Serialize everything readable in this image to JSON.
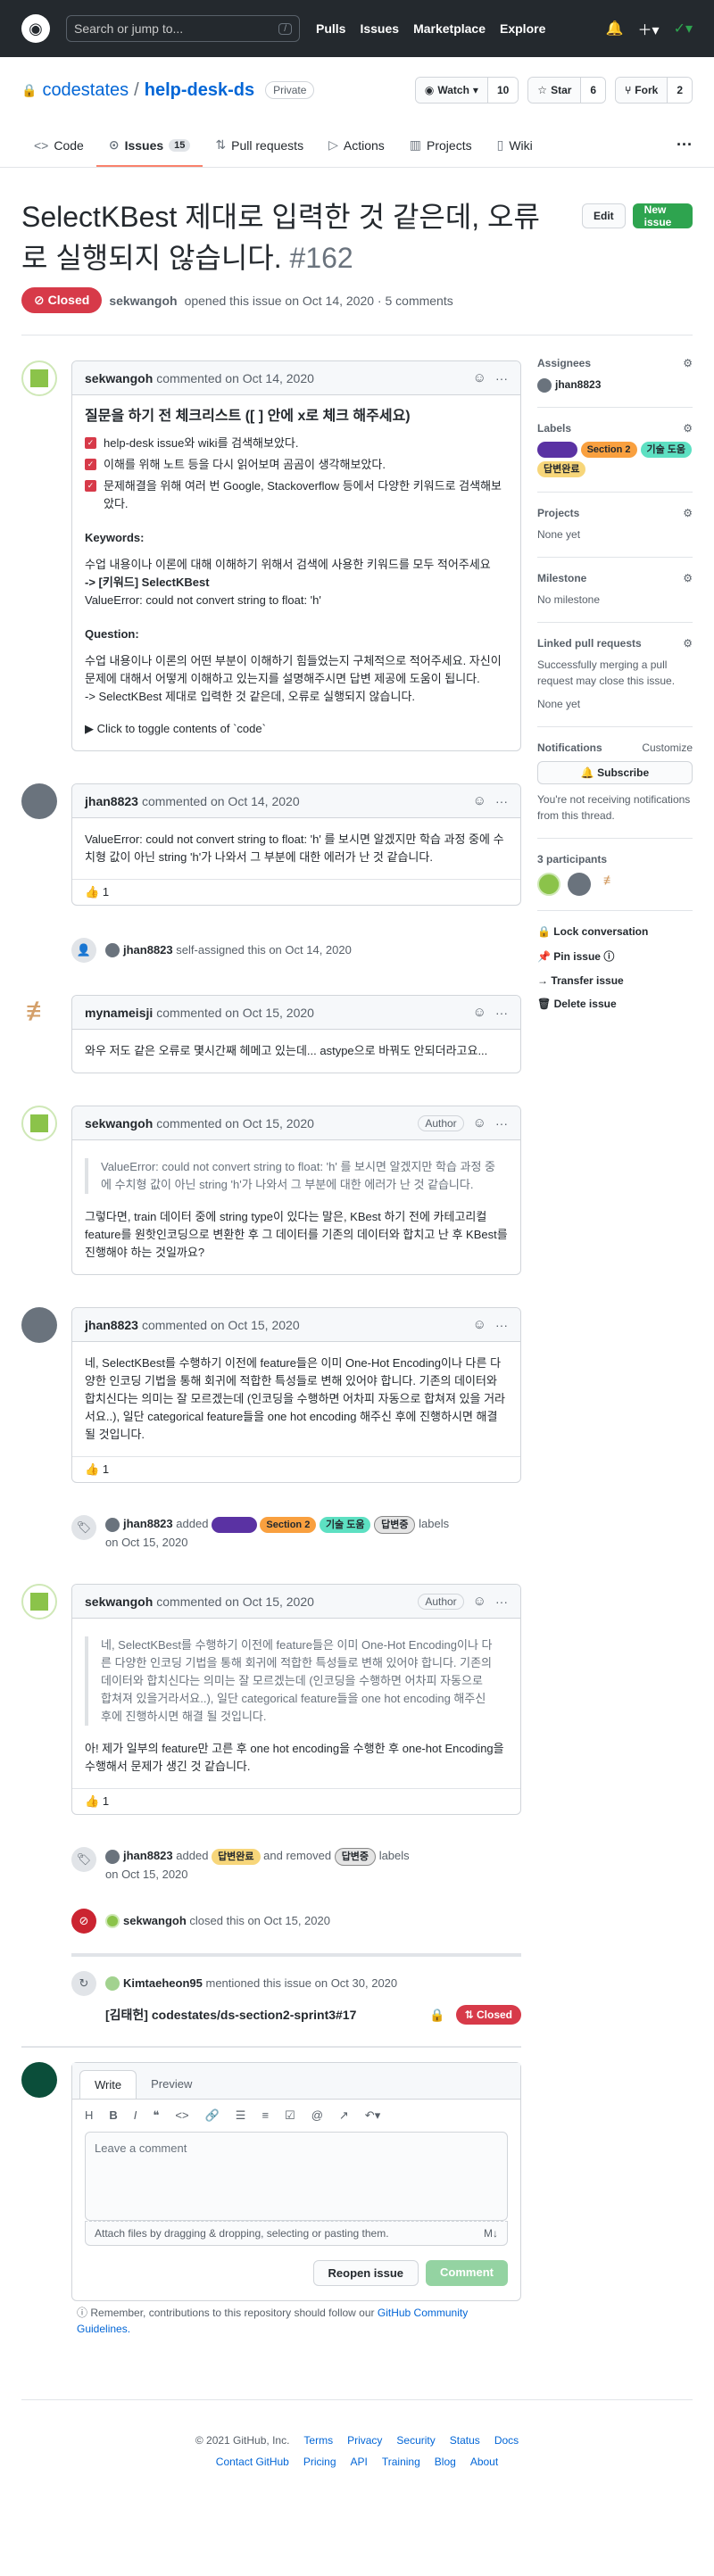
{
  "header": {
    "search_placeholder": "Search or jump to...",
    "search_key": "/",
    "nav": [
      "Pulls",
      "Issues",
      "Marketplace",
      "Explore"
    ]
  },
  "repo": {
    "owner": "codestates",
    "name": "help-desk-ds",
    "visibility": "Private",
    "watch_label": "Watch",
    "watch_count": "10",
    "star_label": "Star",
    "star_count": "6",
    "fork_label": "Fork",
    "fork_count": "2"
  },
  "tabs": {
    "code": "Code",
    "issues": "Issues",
    "issues_count": "15",
    "pulls": "Pull requests",
    "actions": "Actions",
    "projects": "Projects",
    "wiki": "Wiki"
  },
  "issue": {
    "title": "SelectKBest 제대로 입력한 것 같은데, 오류로 실행되지 않습니다.",
    "number": "#162",
    "state": "Closed",
    "author": "sekwangoh",
    "meta": "opened this issue on Oct 14, 2020 · 5 comments",
    "edit_label": "Edit",
    "new_label": "New issue"
  },
  "comments": [
    {
      "author": "sekwangoh",
      "date": "commented on Oct 14, 2020",
      "heading": "질문을 하기 전 체크리스트 ([ ] 안에 x로 체크 해주세요)",
      "checks": [
        "help-desk issue와 wiki를 검색해보았다.",
        "이해를 위해 노트 등을 다시 읽어보며 곰곰이 생각해보았다.",
        "문제해결을 위해 여러 번 Google, Stackoverflow 등에서 다양한 키워드로 검색해보았다."
      ],
      "kw_label": "Keywords:",
      "kw_text1": "수업 내용이나 이론에 대해 이해하기 위해서 검색에 사용한 키워드를 모두 적어주세요",
      "kw_text2": "-> [키워드] SelectKBest",
      "kw_text3": "ValueError: could not convert string to float: 'h'",
      "q_label": "Question:",
      "q_text1": "수업 내용이나 이론의 어떤 부분이 이해하기 힘들었는지 구체적으로 적어주세요. 자신이 문제에 대해서 어떻게 이해하고 있는지를 설명해주시면 답변 제공에 도움이 됩니다.",
      "q_text2": "-> SelectKBest 제대로 입력한 것 같은데, 오류로 실행되지 않습니다.",
      "toggle": "Click to toggle contents of `code`"
    },
    {
      "author": "jhan8823",
      "date": "commented on Oct 14, 2020",
      "body": "ValueError: could not convert string to float: 'h' 를 보시면 알겠지만 학습 과정 중에 수치형 값이 아닌 string 'h'가 나와서 그 부분에 대한 에러가 난 것 같습니다.",
      "reaction": "1"
    },
    {
      "author": "mynameisji",
      "date": "commented on Oct 15, 2020",
      "body": "와우 저도 같은 오류로 몇시간째 헤메고 있는데... astype으로 바꿔도 안되더라고요..."
    },
    {
      "author": "sekwangoh",
      "date": "commented on Oct 15, 2020",
      "badge": "Author",
      "quote": "ValueError: could not convert string to float: 'h' 를 보시면 알겠지만 학습 과정 중에 수치형 값이 아닌 string 'h'가 나와서 그 부분에 대한 에러가 난 것 같습니다.",
      "body": "그렇다면, train 데이터 중에 string type이 있다는 말은, KBest 하기 전에 카테고리컬 feature를 원핫인코딩으로 변환한 후 그 데이터를 기존의 데이터와 합치고 난 후 KBest를 진행해야 하는 것일까요?"
    },
    {
      "author": "jhan8823",
      "date": "commented on Oct 15, 2020",
      "body": "네, SelectKBest를 수행하기 이전에 feature들은 이미 One-Hot Encoding이나 다른 다양한 인코딩 기법을 통해 회귀에 적합한 특성들로 변해 있어야 합니다. 기존의 데이터와 합치신다는 의미는 잘 모르겠는데 (인코딩을 수행하면 어차피 자동으로 합쳐져 있을 거라서요..), 일단 categorical feature들을 one hot encoding 해주신 후에 진행하시면 해결 될 것입니다.",
      "reaction": "1"
    },
    {
      "author": "sekwangoh",
      "date": "commented on Oct 15, 2020",
      "badge": "Author",
      "quote": "네, SelectKBest를 수행하기 이전에 feature들은 이미 One-Hot Encoding이나 다른 다양한 인코딩 기법을 통해 회귀에 적합한 특성들로 변해 있어야 합니다. 기존의 데이터와 합치신다는 의미는 잘 모르겠는데 (인코딩을 수행하면 어차피 자동으로 합쳐져 있을거라서요..), 일단 categorical feature들을 one hot encoding 해주신 후에 진행하시면 해결 될 것입니다.",
      "body": "아! 제가 일부의 feature만 고른 후 one hot encoding을 수행한 후 one-hot Encoding을 수행해서 문제가 생긴 것 같습니다.",
      "reaction": "1"
    }
  ],
  "events": {
    "assign": {
      "user": "jhan8823",
      "text": "self-assigned this on Oct 14, 2020"
    },
    "label1": {
      "user": "jhan8823",
      "added": "added",
      "labels_text": "labels",
      "date": "on Oct 15, 2020"
    },
    "label2": {
      "user": "jhan8823",
      "added": "added",
      "removed": "and removed",
      "labels_text": "labels",
      "date": "on Oct 15, 2020"
    },
    "closed": {
      "user": "sekwangoh",
      "text": "closed this on Oct 15, 2020"
    },
    "mention": {
      "user": "Kimtaeheon95",
      "text": "mentioned this issue on Oct 30, 2020",
      "link": "[김태헌] codestates/ds-section2-sprint3#17",
      "state": "Closed"
    }
  },
  "labels": {
    "l1": "Section 2",
    "l2": "기술 도움",
    "l3": "답변중",
    "l4": "답변완료"
  },
  "editor": {
    "write": "Write",
    "preview": "Preview",
    "placeholder": "Leave a comment",
    "attach": "Attach files by dragging & dropping, selecting or pasting them.",
    "reopen": "Reopen issue",
    "comment": "Comment",
    "remind1": "Remember, contributions to this repository should follow our",
    "remind_link": "GitHub Community Guidelines."
  },
  "sidebar": {
    "assignees": "Assignees",
    "assignee": "jhan8823",
    "labels": "Labels",
    "projects": "Projects",
    "projects_val": "None yet",
    "milestone": "Milestone",
    "milestone_val": "No milestone",
    "linked": "Linked pull requests",
    "linked_desc": "Successfully merging a pull request may close this issue.",
    "linked_val": "None yet",
    "notif": "Notifications",
    "customize": "Customize",
    "subscribe": "Subscribe",
    "notif_desc": "You're not receiving notifications from this thread.",
    "participants": "3 participants",
    "lock": "Lock conversation",
    "pin": "Pin issue",
    "transfer": "Transfer issue",
    "delete": "Delete issue"
  },
  "footer": {
    "copy": "© 2021 GitHub, Inc.",
    "row1": [
      "Terms",
      "Privacy",
      "Security",
      "Status",
      "Docs"
    ],
    "row2": [
      "Contact GitHub",
      "Pricing",
      "API",
      "Training",
      "Blog",
      "About"
    ]
  }
}
